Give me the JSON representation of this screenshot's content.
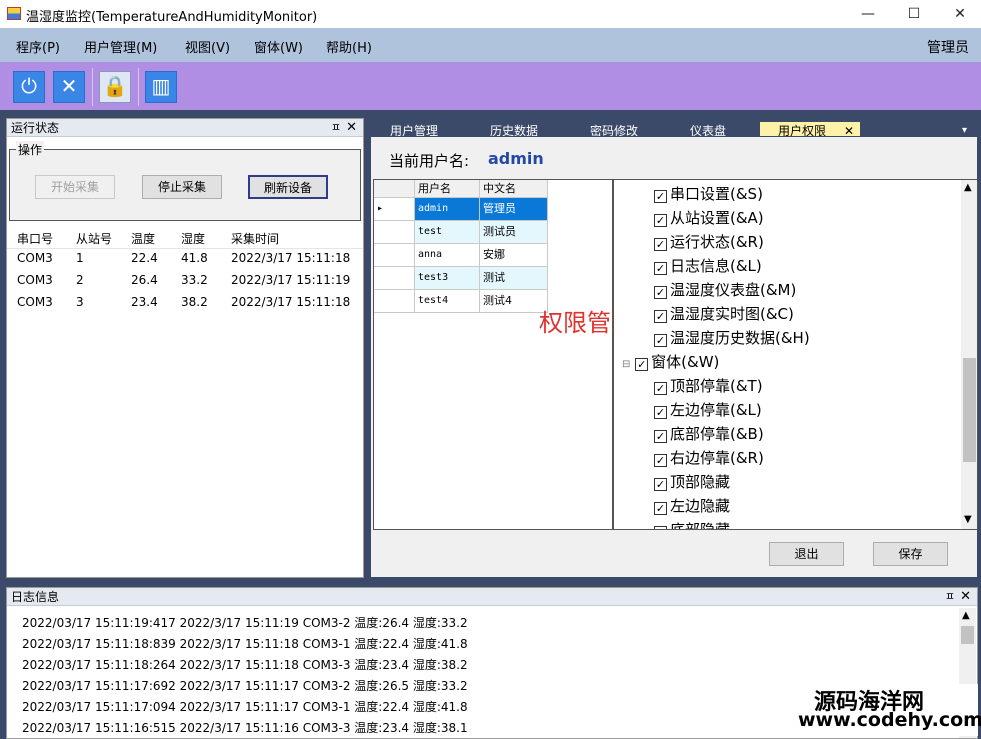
{
  "window": {
    "title": "温湿度监控(TemperatureAndHumidityMonitor)",
    "min": "—",
    "max": "☐",
    "close": "✕"
  },
  "menu": [
    "程序(P)",
    "用户管理(M)",
    "视图(V)",
    "窗体(W)",
    "帮助(H)"
  ],
  "user_label": "管理员",
  "toolbar": {
    "icons": [
      "power-icon",
      "close-icon",
      "lock-icon",
      "chart-icon"
    ]
  },
  "run_status": {
    "title": "运行状态",
    "group": "操作",
    "buttons": [
      "开始采集",
      "停止采集",
      "刷新设备"
    ],
    "columns": [
      "串口号",
      "从站号",
      "温度",
      "湿度",
      "采集时间"
    ],
    "rows": [
      [
        "COM3",
        "1",
        "22.4",
        "41.8",
        "2022/3/17 15:11:18"
      ],
      [
        "COM3",
        "2",
        "26.4",
        "33.2",
        "2022/3/17 15:11:19"
      ],
      [
        "COM3",
        "3",
        "23.4",
        "38.2",
        "2022/3/17 15:11:18"
      ]
    ]
  },
  "tabs": [
    "用户管理",
    "历史数据",
    "密码修改",
    "仪表盘",
    "用户权限"
  ],
  "permission": {
    "current_user_label": "当前用户名:",
    "current_user": "admin",
    "grid_columns": [
      "用户名",
      "中文名"
    ],
    "grid_rows": [
      [
        "admin",
        "管理员"
      ],
      [
        "test",
        "测试员"
      ],
      [
        "anna",
        "安娜"
      ],
      [
        "test3",
        "测试"
      ],
      [
        "test4",
        "测试4"
      ]
    ],
    "overlay": "权限管理",
    "tree": [
      "串口设置(&S)",
      "从站设置(&A)",
      "运行状态(&R)",
      "日志信息(&L)",
      "温湿度仪表盘(&M)",
      "温湿度实时图(&C)",
      "温湿度历史数据(&H)",
      "窗体(&W)",
      "顶部停靠(&T)",
      "左边停靠(&L)",
      "底部停靠(&B)",
      "右边停靠(&R)",
      "顶部隐藏",
      "左边隐藏",
      "底部隐藏"
    ],
    "buttons": [
      "退出",
      "保存"
    ]
  },
  "log": {
    "title": "日志信息",
    "lines": [
      "2022/03/17 15:11:19:417  2022/3/17 15:11:19 COM3-2 温度:26.4 湿度:33.2",
      "2022/03/17 15:11:18:839  2022/3/17 15:11:18 COM3-1 温度:22.4 湿度:41.8",
      "2022/03/17 15:11:18:264  2022/3/17 15:11:18 COM3-3 温度:23.4 湿度:38.2",
      "2022/03/17 15:11:17:692  2022/3/17 15:11:17 COM3-2 温度:26.5 湿度:33.2",
      "2022/03/17 15:11:17:094  2022/3/17 15:11:17 COM3-1 温度:22.4 湿度:41.8",
      "2022/03/17 15:11:16:515  2022/3/17 15:11:16 COM3-3 温度:23.4 湿度:38.1"
    ]
  },
  "watermark": [
    "源码海洋网",
    "www.codehy.com"
  ]
}
